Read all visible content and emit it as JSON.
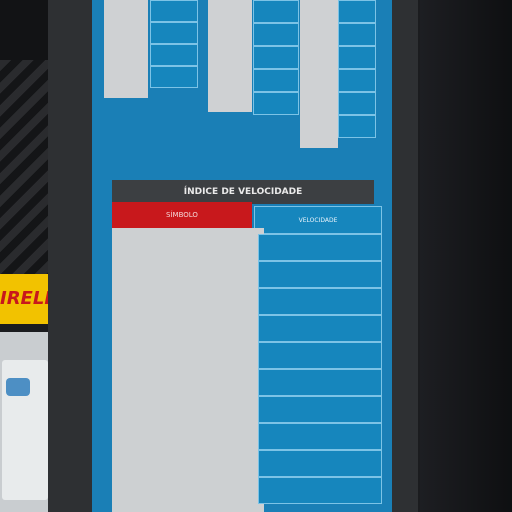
{
  "table_title": "ÍNDICE DE VELOCIDADE",
  "header_left": "SÍMBOLO",
  "header_right": "VELOCIDADE"
}
